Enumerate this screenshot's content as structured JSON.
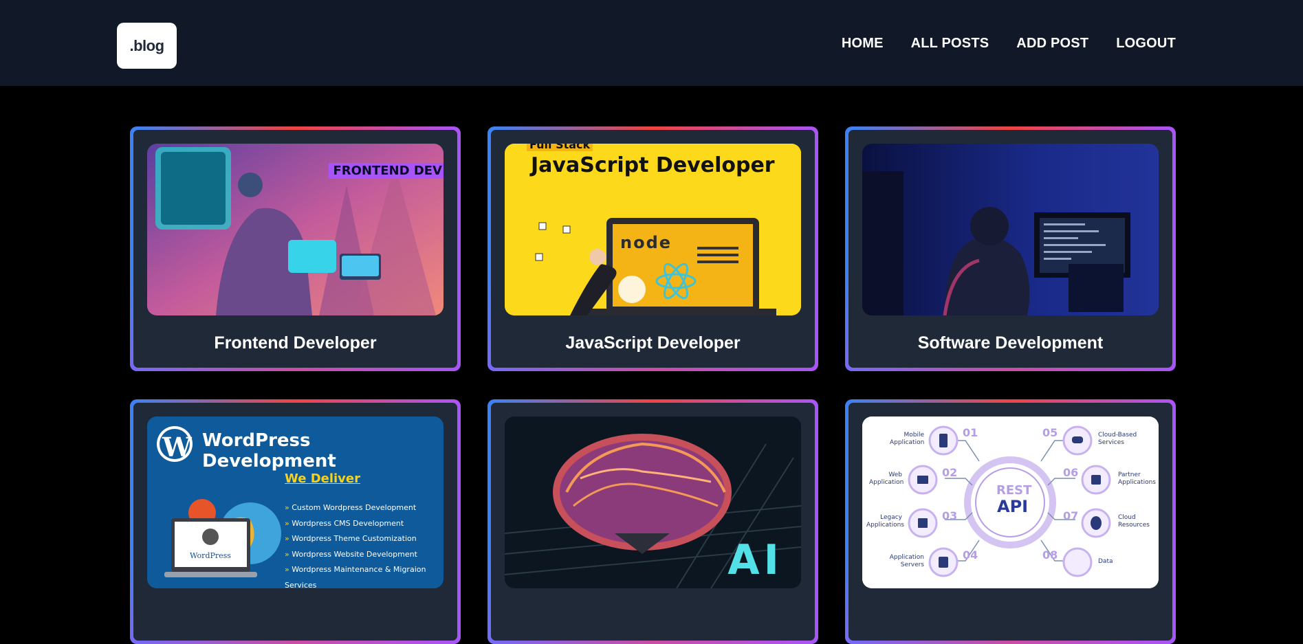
{
  "header": {
    "logo_text": ".blog",
    "nav": [
      "HOME",
      "ALL POSTS",
      "ADD POST",
      "LOGOUT"
    ]
  },
  "posts": [
    {
      "title": "Frontend Developer",
      "image_text": "FRONTEND DEV",
      "image_subject": "developer-illustration"
    },
    {
      "title": "JavaScript Developer",
      "image_text": "JavaScript Developer",
      "image_tag": "Full Stack",
      "image_subject": "laptop-node-react"
    },
    {
      "title": "Software Development",
      "image_subject": "developer-at-monitors"
    },
    {
      "title": "",
      "image_heading": "WordPress Development",
      "image_subheading": "We Deliver",
      "image_list": [
        "Custom Wordpress Development",
        "Wordpress CMS Development",
        "Wordpress Theme Customization",
        "Wordpress Website Development",
        "Wordpress Maintenance & Migraion Services"
      ],
      "image_logo_text": "WordPress"
    },
    {
      "title": "",
      "image_text": "AI",
      "image_subject": "brain-circuit"
    },
    {
      "title": "",
      "image_center_top": "REST",
      "image_center_bottom": "API",
      "image_items": [
        {
          "num": "01",
          "label": "Mobile Application"
        },
        {
          "num": "02",
          "label": "Web Application"
        },
        {
          "num": "03",
          "label": "Legacy Applications"
        },
        {
          "num": "04",
          "label": "Application Servers"
        },
        {
          "num": "05",
          "label": "Cloud-Based Services"
        },
        {
          "num": "06",
          "label": "Partner Applications"
        },
        {
          "num": "07",
          "label": "Cloud Resources"
        },
        {
          "num": "08",
          "label": "Data"
        }
      ]
    }
  ]
}
